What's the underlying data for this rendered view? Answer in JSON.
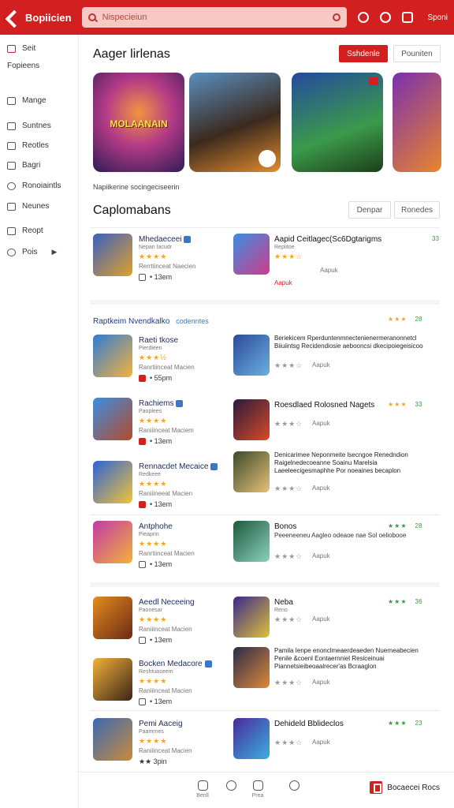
{
  "header": {
    "brand": "Bopiicien",
    "search_placeholder": "Nispecieiun",
    "right_link": "Sponi"
  },
  "sidebar": {
    "items": [
      {
        "label": "Seit",
        "icon": "home-icon"
      },
      {
        "label": "Fopieens",
        "icon": ""
      },
      {
        "label": "Mange",
        "icon": "apps-icon"
      },
      {
        "label": "Suntnes",
        "icon": "bell-icon"
      },
      {
        "label": "Reotles",
        "icon": "book-icon"
      },
      {
        "label": "Bagri",
        "icon": "card-icon"
      },
      {
        "label": "Ronoiaintls",
        "icon": "clock-icon"
      },
      {
        "label": "Neunes",
        "icon": "pen-icon"
      },
      {
        "label": "Reopt",
        "icon": "gift-icon"
      },
      {
        "label": "Pois",
        "icon": "more-icon"
      }
    ]
  },
  "featured": {
    "title": "Aager lirlenas",
    "primary_button": "Sshdenle",
    "secondary_button": "Pouniten",
    "banners": [
      {
        "label": "MOLAANAIN"
      },
      {
        "label": ""
      },
      {
        "label": ""
      },
      {
        "label": ""
      }
    ],
    "note": "Napiikerine  socingeciseerin"
  },
  "section": {
    "title": "Caplomabans",
    "button_a": "Denpar",
    "button_b": "Ronedes",
    "category_line": "Raptkeim Nvendkalko",
    "category_sub": "codenntes"
  },
  "left_apps": [
    {
      "name": "Mhedaeceei",
      "sub": "Nepan Iacudr",
      "stars": "★★★★",
      "dev": "Rerrtiinceat  Naecien",
      "meta": "• 13em",
      "verified": true,
      "red": false
    },
    {
      "name": "Raeti tkose",
      "sub": "Pierdieen",
      "stars": "★★★½",
      "dev": "Ranrtiinceat  Macien",
      "meta": "• 55pm",
      "verified": false,
      "red": true
    },
    {
      "name": "Rachiems",
      "sub": "Paoplees",
      "stars": "★★★★",
      "dev": "Raniiinceat  Maciem",
      "meta": "• 13em",
      "verified": true,
      "red": true
    },
    {
      "name": "Rennacdet Mecaice",
      "sub": "Redkeee",
      "stars": "★★★★",
      "dev": "Raniiineeat  Macien",
      "meta": "• 13em",
      "verified": true,
      "red": true
    },
    {
      "name": "Antphohe",
      "sub": "Pieaprin",
      "stars": "★★★★",
      "dev": "Ranrtiinceat  Macien",
      "meta": "• 13em",
      "verified": false,
      "red": false
    },
    {
      "name": "Aeedl Neceeing",
      "sub": "Paonesar",
      "stars": "★★★★",
      "dev": "Raniiinceat  Macien",
      "meta": "• 13em",
      "verified": false,
      "red": false
    },
    {
      "name": "Bocken Medacore",
      "sub": "Reshtuaseern",
      "stars": "★★★★",
      "dev": "Raniiinceat  Macien",
      "meta": "• 13em",
      "verified": true,
      "red": false
    },
    {
      "name": "Pemi Aaceig",
      "sub": "Paamrnes",
      "stars": "★★★★",
      "dev": "Raniiinceat  Macien",
      "meta": "★★ 3pin",
      "verified": false,
      "red": false
    }
  ],
  "right_apps": [
    {
      "name": "Aapid Ceitlagec(Sc6Dgtarigms",
      "sub": "Repiitoe",
      "stars": "★★★☆",
      "cap": "Aapuk",
      "desc": "",
      "badge_stars": "",
      "badge_num": "33"
    },
    {
      "name": "",
      "sub": "",
      "stars": "★★★☆",
      "cap": "Aapuk",
      "desc": "Beriekicem Rperduntenmnectenienermeranonnetcl Biiuiintsg Recidendiosie aebooncsi dkecipoiegeisicoo",
      "badge_stars": "★★★",
      "badge_num": "28"
    },
    {
      "name": "Roesdlaed  Rolosned Nagets",
      "sub": "",
      "stars": "★★★☆",
      "cap": "Aapuk",
      "desc": "",
      "badge_stars": "★★★",
      "badge_num": "33"
    },
    {
      "name": "",
      "sub": "",
      "stars": "★★★☆",
      "cap": "Aapuk",
      "desc": "Denicarimee Neponmeite lsecngoe Renedndion Raigelnedecoeanne Soainu Marelsia Laeeleecigesmaphhe Por noeaines becaplon",
      "badge_stars": "",
      "badge_num": ""
    },
    {
      "name": "Bonos",
      "sub": "Peeeneeneu Aagleo  odeaoe nae Sol oeliobooe",
      "stars": "★★★☆",
      "cap": "Aapuk",
      "desc": "",
      "badge_stars": "★★★",
      "badge_num": "28"
    },
    {
      "name": "Neba",
      "sub": "Reno",
      "stars": "★★★☆",
      "cap": "Aapuk",
      "desc": "",
      "badge_stars": "★★★",
      "badge_num": "36"
    },
    {
      "name": "",
      "sub": "",
      "stars": "★★★☆",
      "cap": "Aapuk",
      "desc": "Pamila Ienpe enonclmeaerdeaeden Nuerneabecien Penile &coenl Eontaernniel Resiceinuai Piannetsieibeoaalrecer'as Bcraaglon",
      "badge_stars": "",
      "badge_num": ""
    },
    {
      "name": "Dehideld  Bblideclos",
      "sub": "",
      "stars": "★★★☆",
      "cap": "Aapuk",
      "desc": "",
      "badge_stars": "★★★",
      "badge_num": "23"
    }
  ],
  "bottom": {
    "nav": [
      {
        "label": "Benll"
      },
      {
        "label": ""
      },
      {
        "label": "Prea"
      },
      {
        "label": ""
      }
    ],
    "cta": "Bocaecei Rocs"
  }
}
